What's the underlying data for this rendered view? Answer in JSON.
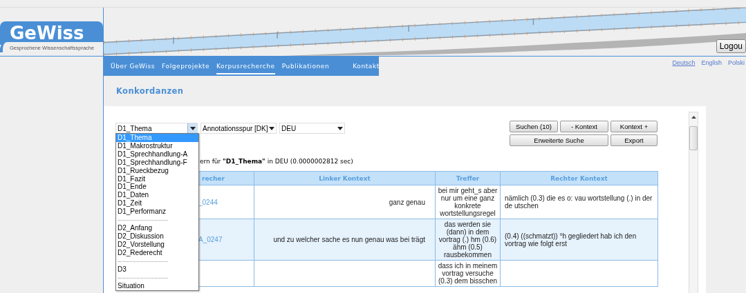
{
  "logo": {
    "name": "GeWiss",
    "subtitle": "Gesprochene Wissenschaftssprache"
  },
  "header": {
    "logout": "Logou"
  },
  "nav": [
    {
      "label": "Über GeWiss",
      "selected": false
    },
    {
      "label": "Folgeprojekte",
      "selected": false
    },
    {
      "label": "Korpusrecherche",
      "selected": true
    },
    {
      "label": "Publikationen",
      "selected": false
    },
    {
      "label": "Kontakt",
      "selected": false
    }
  ],
  "languages": [
    {
      "label": "Deutsch",
      "selected": true
    },
    {
      "label": "English",
      "selected": false
    },
    {
      "label": "Polski",
      "selected": false
    }
  ],
  "page_title": "Konkordanzen",
  "filters": [
    {
      "value": "D1_Thema",
      "open": true,
      "options": [
        {
          "kind": "option",
          "label": "D1_Thema",
          "selected": true
        },
        {
          "kind": "option",
          "label": "D1_Makrostruktur",
          "selected": false
        },
        {
          "kind": "option",
          "label": "D1_Sprechhandlung-A",
          "selected": false
        },
        {
          "kind": "option",
          "label": "D1_Sprechhandlung-F",
          "selected": false
        },
        {
          "kind": "option",
          "label": "D1_Rueckbezug",
          "selected": false
        },
        {
          "kind": "option",
          "label": "D1_Fazit",
          "selected": false
        },
        {
          "kind": "option",
          "label": "D1_Ende",
          "selected": false
        },
        {
          "kind": "option",
          "label": "D1_Daten",
          "selected": false
        },
        {
          "kind": "option",
          "label": "D1_Zeit",
          "selected": false
        },
        {
          "kind": "option",
          "label": "D1_Performanz",
          "selected": false
        },
        {
          "kind": "separator"
        },
        {
          "kind": "option",
          "label": "D2_Anfang",
          "selected": false
        },
        {
          "kind": "option",
          "label": "D2_Diskussion",
          "selected": false
        },
        {
          "kind": "option",
          "label": "D2_Vorstellung",
          "selected": false
        },
        {
          "kind": "option",
          "label": "D2_Rederecht",
          "selected": false
        },
        {
          "kind": "separator"
        },
        {
          "kind": "option",
          "label": "D3",
          "selected": false
        },
        {
          "kind": "separator"
        },
        {
          "kind": "option",
          "label": "Situation",
          "selected": false
        }
      ]
    },
    {
      "value": "Annotationsspur [DK]",
      "open": false
    },
    {
      "value": "DEU",
      "open": false
    }
  ],
  "buttons": [
    {
      "label": "Suchen (10)",
      "kind": "normal"
    },
    {
      "label": "- Kontext",
      "kind": "normal"
    },
    {
      "label": "Kontext +",
      "kind": "normal"
    },
    {
      "label": "Erweiterte Suche",
      "kind": "wide"
    },
    {
      "label": "Export",
      "kind": "normal"
    }
  ],
  "summary": "ern für **\"D1_Thema\"** in DEU (0.0000002812 sec)",
  "table": {
    "columns": [
      "recher",
      "Linker Kontext",
      "Treffer",
      "Rechter Kontext"
    ],
    "rows": [
      {
        "cells": [
          "_0244",
          "ganz genau",
          "bei mir geht_s aber nur um eine ganz konkrete wortstellungsregel",
          "nämlich (0.3) die es o: vau wortstellung (.) in der de utschen"
        ]
      },
      {
        "cells": [
          "A_0247",
          "und zu welcher sache es nun genau was bei trägt",
          "das werden sie (dann) in dem vortrag (.) hm (0.6) ähm (0.5) rausbekommen",
          "(0.4) ((schmatzt)) °h gegliedert hab ich den vortrag wie folgt erst"
        ]
      },
      {
        "cells": [
          "",
          "",
          "dass ich in meinem vortrag versuche (0.3) dem bisschen",
          ""
        ]
      }
    ]
  }
}
